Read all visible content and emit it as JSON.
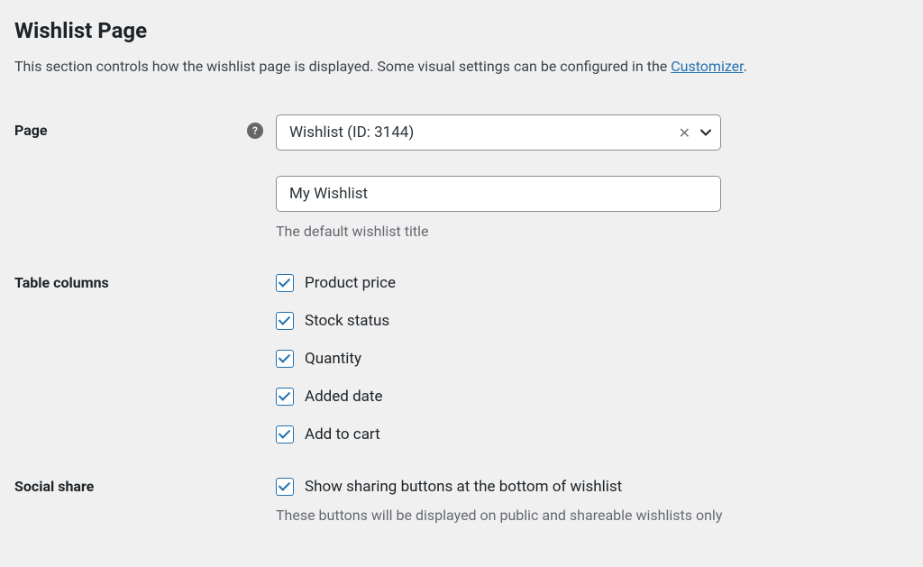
{
  "heading": "Wishlist Page",
  "intro": {
    "text_before": "This section controls how the wishlist page is displayed. Some visual settings can be configured in the ",
    "link_text": "Customizer",
    "text_after": "."
  },
  "page_field": {
    "label": "Page",
    "help_glyph": "?",
    "selected": "Wishlist (ID: 3144)"
  },
  "title_field": {
    "value": "My Wishlist",
    "description": "The default wishlist title"
  },
  "table_columns": {
    "label": "Table columns",
    "options": [
      {
        "label": "Product price",
        "checked": true
      },
      {
        "label": "Stock status",
        "checked": true
      },
      {
        "label": "Quantity",
        "checked": true
      },
      {
        "label": "Added date",
        "checked": true
      },
      {
        "label": "Add to cart",
        "checked": true
      }
    ]
  },
  "social_share": {
    "label": "Social share",
    "option_label": "Show sharing buttons at the bottom of wishlist",
    "checked": true,
    "description": "These buttons will be displayed on public and shareable wishlists only"
  }
}
